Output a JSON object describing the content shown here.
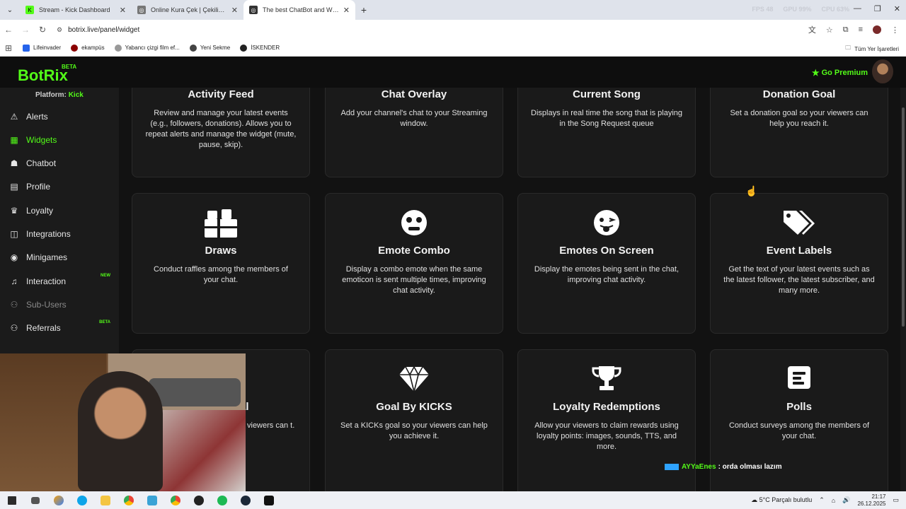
{
  "browser": {
    "tabs": [
      {
        "title": "Stream - Kick Dashboard",
        "fav_color": "#53fc18",
        "active": false
      },
      {
        "title": "Online Kura Çek | Çekiliş Yap",
        "fav_color": "#666666",
        "active": false
      },
      {
        "title": "The best ChatBot and Widgets",
        "fav_color": "#333333",
        "active": true
      }
    ],
    "perf": {
      "fps_label": "FPS",
      "fps": "48",
      "gpu_label": "GPU",
      "gpu": "99%",
      "cpu_label": "CPU",
      "cpu": "63%"
    },
    "url": "botrix.live/panel/widget",
    "bookmarks": [
      "Lifeinvader",
      "ekampüs",
      "Yabancı çizgi film ef...",
      "Yeni Sekme",
      "İSKENDER"
    ],
    "all_bookmarks": "Tüm Yer İşaretleri"
  },
  "header": {
    "logo": "BotRix",
    "logo_badge": "BETA",
    "premium": "Go Premium"
  },
  "sidebar": {
    "platform_label": "Platform:",
    "platform_value": "Kick",
    "items": [
      {
        "label": "Alerts",
        "icon": "warning-icon",
        "glyph": "⚠",
        "badge": ""
      },
      {
        "label": "Widgets",
        "icon": "grid-icon",
        "glyph": "▦",
        "badge": ""
      },
      {
        "label": "Chatbot",
        "icon": "robot-icon",
        "glyph": "🤖",
        "badge": ""
      },
      {
        "label": "Profile",
        "icon": "id-card-icon",
        "glyph": "▤",
        "badge": ""
      },
      {
        "label": "Loyalty",
        "icon": "trophy-icon",
        "glyph": "🏆",
        "badge": ""
      },
      {
        "label": "Integrations",
        "icon": "integrations-icon",
        "glyph": "◫",
        "badge": ""
      },
      {
        "label": "Minigames",
        "icon": "gamepad-icon",
        "glyph": "🎮",
        "badge": ""
      },
      {
        "label": "Interaction",
        "icon": "music-icon",
        "glyph": "♫",
        "badge": "NEW"
      },
      {
        "label": "Sub-Users",
        "icon": "users-icon",
        "glyph": "👥",
        "badge": ""
      },
      {
        "label": "Referrals",
        "icon": "referrals-icon",
        "glyph": "👥",
        "badge": "BETA"
      }
    ]
  },
  "widgets": [
    {
      "title": "Activity Feed",
      "desc": "Review and manage your latest events (e.g., followers, donations). Allows you to repeat alerts and manage the widget (mute, pause, skip).",
      "icon": ""
    },
    {
      "title": "Chat Overlay",
      "desc": "Add your channel's chat to your Streaming window.",
      "icon": ""
    },
    {
      "title": "Current Song",
      "desc": "Displays in real time the song that is playing in the Song Request queue",
      "icon": ""
    },
    {
      "title": "Donation Goal",
      "desc": "Set a donation goal so your viewers can help you reach it.",
      "icon": ""
    },
    {
      "title": "Draws",
      "desc": "Conduct raffles among the members of your chat.",
      "icon": "gift-icon"
    },
    {
      "title": "Emote Combo",
      "desc": "Display a combo emote when the same emoticon is sent multiple times, improving chat activity.",
      "icon": "surprised-face-icon"
    },
    {
      "title": "Emotes On Screen",
      "desc": "Display the emotes being sent in the chat, improving chat activity.",
      "icon": "tongue-face-icon"
    },
    {
      "title": "Event Labels",
      "desc": "Get the text of your latest events such as the latest follower, the latest subscriber, and many more.",
      "icon": "tags-icon"
    },
    {
      "title": "al",
      "desc": "viewers can t.",
      "icon": ""
    },
    {
      "title": "Goal By KICKS",
      "desc": "Set a KICKs goal so your viewers can help you achieve it.",
      "icon": "diamond-icon"
    },
    {
      "title": "Loyalty Redemptions",
      "desc": "Allow your viewers to claim rewards using loyalty points: images, sounds, TTS, and more.",
      "icon": "trophy-icon"
    },
    {
      "title": "Polls",
      "desc": "Conduct surveys among the members of your chat.",
      "icon": "poll-icon"
    }
  ],
  "chat_overlay": {
    "user": "AYYaEnes",
    "message": ": orda olması lazım"
  },
  "taskbar": {
    "weather": "5°C  Parçalı bulutlu",
    "time": "21:17",
    "date": "26.12.2025"
  }
}
